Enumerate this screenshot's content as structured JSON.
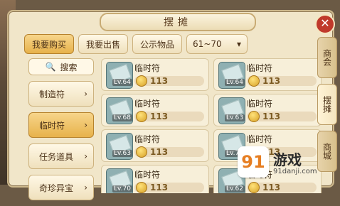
{
  "window": {
    "title": "摆摊",
    "close_icon": "✕"
  },
  "top_tabs": [
    {
      "label": "我要购买",
      "active": true
    },
    {
      "label": "我要出售",
      "active": false
    },
    {
      "label": "公示物品",
      "active": false
    },
    {
      "label": "61~70",
      "active": false
    }
  ],
  "sidebar": {
    "search_label": "搜索",
    "items": [
      {
        "label": "制造符",
        "active": false
      },
      {
        "label": "临时符",
        "active": true
      },
      {
        "label": "任务道具",
        "active": false
      },
      {
        "label": "奇珍异宝",
        "active": false
      }
    ]
  },
  "side_tabs": [
    {
      "label": "商会",
      "active": false
    },
    {
      "label": "摆摊",
      "active": true
    },
    {
      "label": "商城",
      "active": false
    }
  ],
  "items": [
    {
      "name": "临时符",
      "level": "Lv.64",
      "price": "113"
    },
    {
      "name": "临时符",
      "level": "Lv.64",
      "price": "113"
    },
    {
      "name": "临时符",
      "level": "Lv.68",
      "price": "113"
    },
    {
      "name": "临时符",
      "level": "Lv.63",
      "price": "113"
    },
    {
      "name": "临时符",
      "level": "Lv.63",
      "price": "113"
    },
    {
      "name": "临时符",
      "level": "Lv.70",
      "price": "113"
    },
    {
      "name": "临时符",
      "level": "Lv.70",
      "price": "113"
    },
    {
      "name": "临时符",
      "level": "Lv.62",
      "price": "113"
    }
  ],
  "watermark": {
    "logo": "91",
    "title": "游戏",
    "url": "91danji.com"
  },
  "colors": {
    "active_tab": "#e7b24b",
    "panel": "#f1e6c9",
    "close": "#c0392b"
  }
}
